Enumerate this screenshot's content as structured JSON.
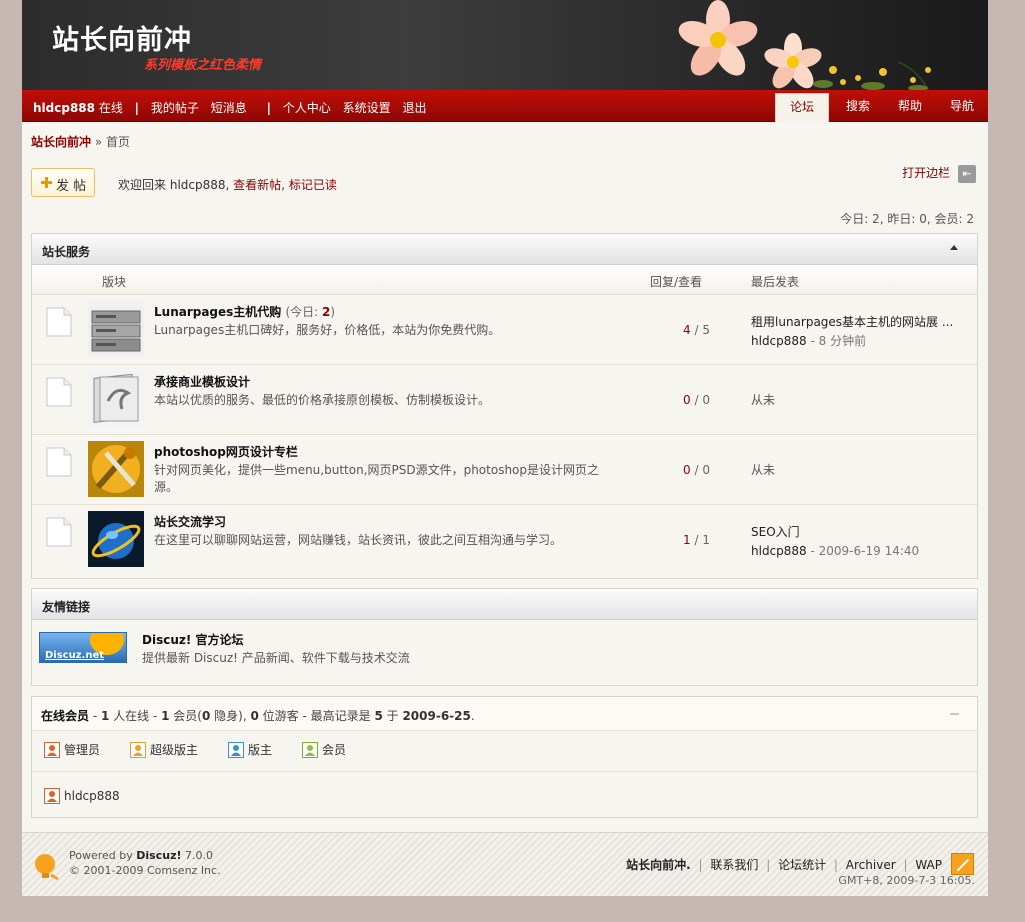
{
  "header": {
    "site_title": "站长向前冲",
    "tagline": "系列模板之红色柔情"
  },
  "userbar": {
    "username": "hldcp888",
    "status": "在线",
    "links": [
      "我的帖子",
      "短消息",
      "个人中心",
      "系统设置",
      "退出"
    ]
  },
  "nav_tabs": [
    "论坛",
    "搜索",
    "帮助",
    "导航"
  ],
  "breadcrumb": {
    "home": "站长向前冲",
    "sep": "»",
    "current": "首页"
  },
  "toolbar": {
    "post_button": "发 帖",
    "welcome_prefix": "欢迎回来",
    "welcome_user": "hldcp888,",
    "view_new": "查看新帖",
    "comma": ",",
    "mark_read": "标记已读",
    "sidebar_toggle": "打开边栏",
    "sidebar_icon": "⇤"
  },
  "stats": "今日: 2, 昨日: 0, 会员: 2",
  "forum_section": {
    "title": "站长服务",
    "col_forum": "版块",
    "col_counts": "回复/查看",
    "col_last": "最后发表",
    "forums": [
      {
        "name": "Lunarpages主机代购",
        "today_label": "(今日: ",
        "today_count": "2",
        "today_close": ")",
        "desc": "Lunarpages主机口碑好，服务好，价格低，本站为你免费代购。",
        "replies": "4",
        "slash": " / ",
        "views": "5",
        "last_title": "租用lunarpages基本主机的网站展 ...",
        "last_user": "hldcp888",
        "last_time": " - 8 分钟前"
      },
      {
        "name": "承接商业模板设计",
        "desc": "本站以优质的服务、最低的价格承接原创模板、仿制模板设计。",
        "replies": "0",
        "slash": " / ",
        "views": "0",
        "last_never": "从未"
      },
      {
        "name": "photoshop网页设计专栏",
        "desc": "针对网页美化，提供一些menu,button,网页PSD源文件，photoshop是设计网页之源。",
        "replies": "0",
        "slash": " / ",
        "views": "0",
        "last_never": "从未"
      },
      {
        "name": "站长交流学习",
        "desc": "在这里可以聊聊网站运营，网站赚钱，站长资讯，彼此之间互相沟通与学习。",
        "replies": "1",
        "slash": " / ",
        "views": "1",
        "last_title": "SEO入门",
        "last_user": "hldcp888",
        "last_time": " - 2009-6-19 14:40"
      }
    ]
  },
  "links_section": {
    "title": "友情链接",
    "logo_text": "Discuz.net",
    "link_title": "Discuz! 官方论坛",
    "link_desc": "提供最新 Discuz! 产品新闻、软件下载与技术交流"
  },
  "online": {
    "title": "在线会员",
    "p1": " - ",
    "n1": "1",
    "p2": " 人在线 - ",
    "n2": "1",
    "p3": " 会员(",
    "n3": "0",
    "p4": " 隐身), ",
    "n4": "0",
    "p5": " 位游客 - 最高记录是 ",
    "n5": "5",
    "p6": " 于 ",
    "n6": "2009-6-25",
    "p7": ".",
    "legend": [
      "管理员",
      "超级版主",
      "版主",
      "会员"
    ],
    "users": [
      "hldcp888"
    ]
  },
  "footer": {
    "powered_by": "Powered by ",
    "brand": "Discuz!",
    "version": " 7.0.0",
    "copyright": "© 2001-2009 Comsenz Inc.",
    "site": "站长向前冲.",
    "links": [
      "联系我们",
      "论坛统计",
      "Archiver",
      "WAP"
    ],
    "time": "GMT+8, 2009-7-3 16:05."
  },
  "colors": {
    "nav_red": "#b00b06",
    "accent_red": "#8b0000",
    "page_bg": "#f7f5ef",
    "outer_bg": "#c5b7b1"
  }
}
